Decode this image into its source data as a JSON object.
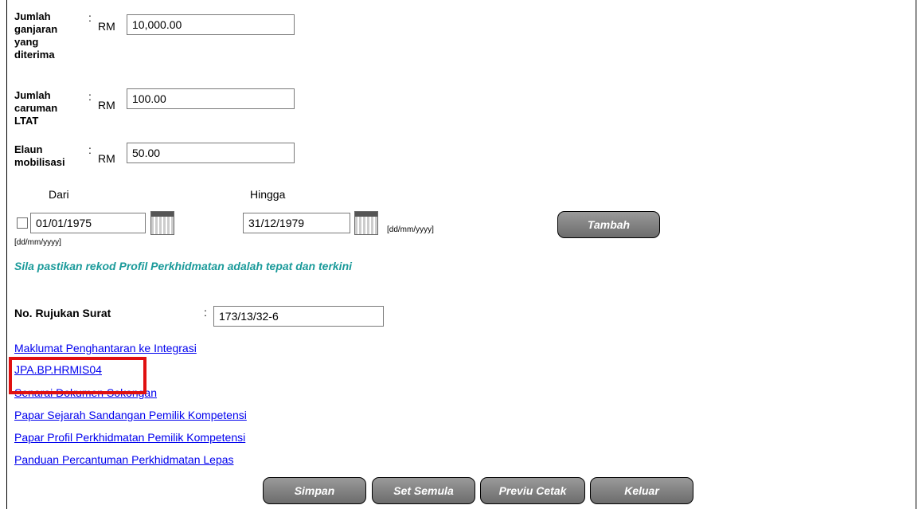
{
  "fields": {
    "jumlah_ganjaran": {
      "label_lines": [
        "Jumlah",
        "ganjaran",
        "yang",
        "diterima"
      ],
      "colon": ":",
      "currency": "RM",
      "value": "10,000.00"
    },
    "jumlah_caruman": {
      "label_lines": [
        "Jumlah",
        "caruman",
        "LTAT"
      ],
      "colon": ":",
      "currency": "RM",
      "value": "100.00"
    },
    "elaun_mobilisasi": {
      "label_lines": [
        "Elaun",
        "mobilisasi"
      ],
      "colon": ":",
      "currency": "RM",
      "value": "50.00"
    }
  },
  "dates": {
    "from_label": "Dari",
    "to_label": "Hingga",
    "from_value": "01/01/1975",
    "to_value": "31/12/1979",
    "format_hint": "[dd/mm/yyyy]",
    "checkbox_checked": false
  },
  "tambah_label": "Tambah",
  "notice": "Sila pastikan rekod Profil Perkhidmatan adalah tepat dan terkini",
  "rujukan": {
    "label": "No. Rujukan Surat",
    "colon": ":",
    "value": "173/13/32-6"
  },
  "links": [
    "Maklumat Penghantaran ke Integrasi",
    "JPA.BP.HRMIS04",
    "Senarai Dokumen Sokongan",
    "Papar Sejarah Sandangan Pemilik Kompetensi",
    "Papar Profil Perkhidmatan Pemilik Kompetensi",
    "Panduan Percantuman Perkhidmatan Lepas"
  ],
  "buttons": {
    "simpan": "Simpan",
    "set_semula": "Set Semula",
    "previu_cetak": "Previu Cetak",
    "keluar": "Keluar"
  },
  "highlight_color": "#e01010"
}
